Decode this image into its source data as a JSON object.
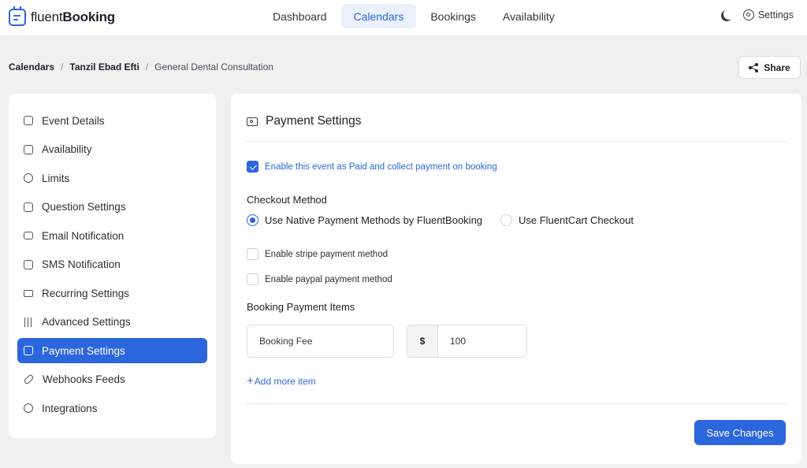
{
  "brand": {
    "prefix": "fluent",
    "suffix": "Booking"
  },
  "nav": {
    "items": [
      "Dashboard",
      "Calendars",
      "Bookings",
      "Availability"
    ],
    "active": "Calendars"
  },
  "topbar": {
    "settings_label": "Settings"
  },
  "breadcrumb": {
    "items": [
      "Calendars",
      "Tanzil Ebad Efti",
      "General Dental Consultation"
    ],
    "separator": "/"
  },
  "share_label": "Share",
  "sidebar": {
    "items": [
      {
        "label": "Event Details",
        "icon": "event-details-icon"
      },
      {
        "label": "Availability",
        "icon": "calendar-icon"
      },
      {
        "label": "Limits",
        "icon": "clock-icon"
      },
      {
        "label": "Question Settings",
        "icon": "question-icon"
      },
      {
        "label": "Email Notification",
        "icon": "mail-icon"
      },
      {
        "label": "SMS Notification",
        "icon": "sms-icon"
      },
      {
        "label": "Recurring Settings",
        "icon": "repeat-icon"
      },
      {
        "label": "Advanced Settings",
        "icon": "sliders-icon"
      },
      {
        "label": "Payment Settings",
        "icon": "payment-icon"
      },
      {
        "label": "Webhooks Feeds",
        "icon": "link-icon"
      },
      {
        "label": "Integrations",
        "icon": "integrations-icon"
      }
    ],
    "active": "Payment Settings"
  },
  "panel": {
    "title": "Payment Settings",
    "paid_toggle": {
      "label": "Enable this event as Paid and collect payment on booking",
      "checked": true
    },
    "checkout": {
      "label": "Checkout Method",
      "options": [
        "Use Native Payment Methods by FluentBooking",
        "Use FluentCart Checkout"
      ],
      "selected": "Use Native Payment Methods by FluentBooking"
    },
    "stripe": {
      "label": "Enable stripe payment method",
      "checked": false
    },
    "paypal": {
      "label": "Enable paypal payment method",
      "checked": false
    },
    "items": {
      "label": "Booking Payment Items",
      "rows": [
        {
          "name": "Booking Fee",
          "currency": "$",
          "price": "100"
        }
      ]
    },
    "add_item_label": "Add more item",
    "save_label": "Save Changes"
  },
  "colors": {
    "accent": "#2c66dd",
    "accent_soft": "#eaf1fd",
    "background": "#f0f0f1"
  }
}
